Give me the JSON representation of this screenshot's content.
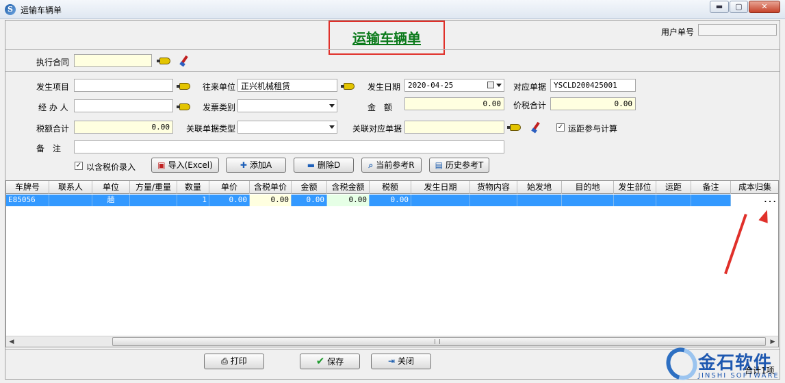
{
  "window": {
    "title": "运输车辆单",
    "minimize": "▬",
    "maximize": "▢",
    "close": "✕"
  },
  "header": {
    "form_title": "运输车辆单",
    "user_no_label": "用户单号",
    "user_no_value": ""
  },
  "contract": {
    "label": "执行合同",
    "value": ""
  },
  "fields": {
    "item_label": "发生项目",
    "item_value": "",
    "partner_label": "往来单位",
    "partner_value": "正兴机械租赁",
    "date_label": "发生日期",
    "date_value": "2020-04-25",
    "ref_label": "对应单据",
    "ref_value": "YSCLD200425001",
    "handler_label": "经 办 人",
    "handler_value": "",
    "invoice_label": "发票类别",
    "invoice_value": "",
    "amount_label": "金　额",
    "amount_value": "0.00",
    "total_tax_label": "价税合计",
    "total_tax_value": "0.00",
    "tax_label": "税额合计",
    "tax_value": "0.00",
    "rel_type_label": "关联单据类型",
    "rel_type_value": "",
    "rel_doc_label": "关联对应单据",
    "rel_doc_value": "",
    "distance_label": "运距参与计算",
    "distance_checked": "✓",
    "remark_label": "备　注",
    "remark_value": ""
  },
  "toolbar": {
    "tax_entry_label": "以含税价录入",
    "tax_entry_checked": "✓",
    "import_label": "导入(Excel)",
    "add_label": "添加A",
    "delete_label": "删除D",
    "current_ref_label": "当前参考R",
    "history_ref_label": "历史参考T"
  },
  "grid": {
    "columns": [
      "车牌号",
      "联系人",
      "单位",
      "方量/重量",
      "数量",
      "单价",
      "含税单价",
      "金额",
      "含税金额",
      "税额",
      "发生日期",
      "货物内容",
      "始发地",
      "目的地",
      "发生部位",
      "运距",
      "备注",
      "成本归集"
    ],
    "rows": [
      {
        "plate": "E85056",
        "contact": "",
        "unit": "趟",
        "volume": "",
        "qty": "1",
        "price": "0.00",
        "tax_price": "0.00",
        "amount": "0.00",
        "tax_amount": "0.00",
        "tax": "0.00",
        "date": "",
        "goods": "",
        "origin": "",
        "dest": "",
        "part": "",
        "distance": "",
        "remark": "",
        "cost": "..."
      }
    ]
  },
  "footer": {
    "print_label": "打印",
    "save_label": "保存",
    "close_label": "关闭",
    "total_label": "合计1项"
  },
  "logo": {
    "name": "金石软件",
    "en": "JINSHI SOFTWARE"
  },
  "colors": {
    "title_green": "#0b7a1b",
    "highlight_red": "#e0302a",
    "row_selected": "#3399ff",
    "field_yellow": "#ffffe0"
  }
}
